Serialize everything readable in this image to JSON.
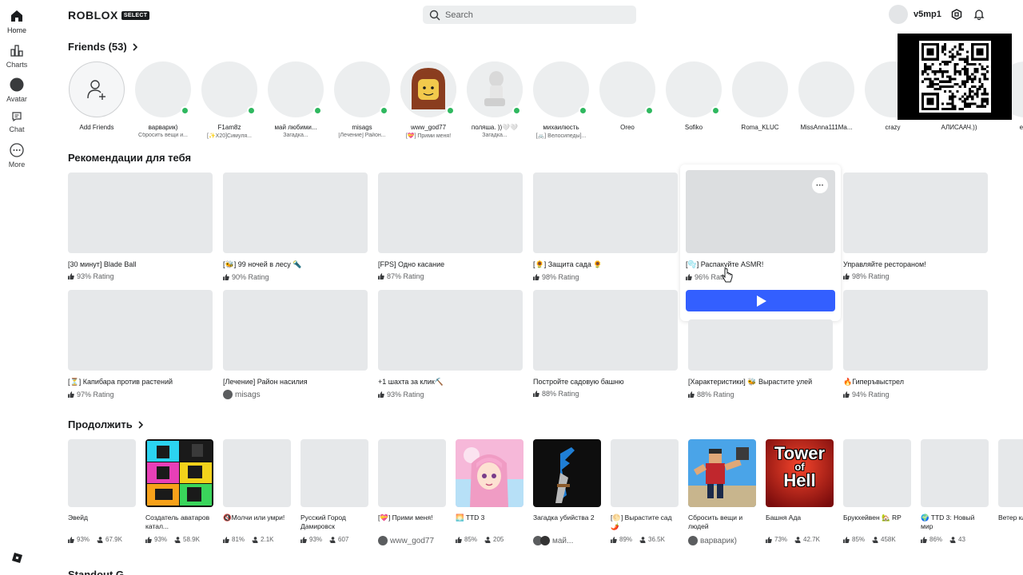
{
  "nav": {
    "items": [
      {
        "label": "Home",
        "icon": "home-icon"
      },
      {
        "label": "Charts",
        "icon": "charts-icon"
      },
      {
        "label": "Avatar",
        "icon": "avatar-icon"
      },
      {
        "label": "Chat",
        "icon": "chat-icon"
      },
      {
        "label": "More",
        "icon": "more-icon"
      }
    ]
  },
  "header": {
    "logo_text": "ROBLOX",
    "logo_badge": "SELECT",
    "search_placeholder": "Search",
    "username": "v5mp1"
  },
  "friends": {
    "title": "Friends (53)",
    "add_label": "Add Friends",
    "items": [
      {
        "name": "варварик)",
        "status": "Сбросить вещи и...",
        "online": true
      },
      {
        "name": "F1am8z",
        "status": "[✨X20]Симуля...",
        "online": true
      },
      {
        "name": "май любими...",
        "status": "Загадка...",
        "online": true
      },
      {
        "name": "misags",
        "status": "[Лечение] Район...",
        "online": true
      },
      {
        "name": "www_god77",
        "status": "[💝] Прими меня!",
        "online": true
      },
      {
        "name": "поляша. ))🤍🤍",
        "status": "Загадка...",
        "online": true
      },
      {
        "name": "михаилюсть",
        "status": "[🚲] Велосипеды]...",
        "online": true
      },
      {
        "name": "Oreo",
        "status": "",
        "online": true
      },
      {
        "name": "Sofiko",
        "status": "",
        "online": true
      },
      {
        "name": "Roma_KLUC",
        "status": "",
        "online": false
      },
      {
        "name": "MissAnna111Ma...",
        "status": "",
        "online": false
      },
      {
        "name": "crazy",
        "status": "",
        "online": false
      },
      {
        "name": "АЛИСААЧ.))",
        "status": "",
        "online": false
      },
      {
        "name": "eles",
        "status": "",
        "online": false
      }
    ]
  },
  "recommendations": {
    "title": "Рекомендации для тебя",
    "row1": [
      {
        "title": "[30 минут] Blade Ball",
        "rating": "93% Rating"
      },
      {
        "title": "[🐝] 99 ночей в лесу 🔦",
        "rating": "90% Rating"
      },
      {
        "title": "[FPS] Одно касание",
        "rating": "87% Rating"
      },
      {
        "title": "[🌻] Защита сада 🌻",
        "rating": "98% Rating"
      },
      {
        "title": "[🫧] Распакуйте ASMR!",
        "rating": "96% Rating"
      },
      {
        "title": "Управляйте рестораном!",
        "rating": "98% Rating"
      }
    ],
    "row2": [
      {
        "title": "[⏳] Капибара против растений",
        "rating": "97% Rating"
      },
      {
        "title": "[Лечение] Район насилия",
        "rating": "misags"
      },
      {
        "title": "+1 шахта за клик⛏️",
        "rating": "93% Rating"
      },
      {
        "title": "Постройте садовую башню",
        "rating": "88% Rating"
      },
      {
        "title": "[Характеристики] 🐝 Вырастите улей",
        "rating": "88% Rating"
      },
      {
        "title": "🔥Гиперъвыстрел",
        "rating": "94% Rating"
      }
    ]
  },
  "continue": {
    "title": "Продолжить",
    "items": [
      {
        "name": "Эвейд",
        "rating": "93%",
        "players": "67.9K"
      },
      {
        "name": "Создатель аватаров катал...",
        "rating": "93%",
        "players": "58.9K"
      },
      {
        "name": "🔇Молчи или умри!",
        "rating": "81%",
        "players": "2.1K"
      },
      {
        "name": "Русский Город Дамировск",
        "rating": "93%",
        "players": "607"
      },
      {
        "name": "[💝] Прими меня!",
        "rating": "",
        "players": "www_god77"
      },
      {
        "name": "🌅 TTD 3",
        "rating": "85%",
        "players": "205"
      },
      {
        "name": "Загадка убийства 2",
        "rating": "",
        "players": "май..."
      },
      {
        "name": "[🌕] Вырастите сад 🌶️",
        "rating": "89%",
        "players": "36.5K"
      },
      {
        "name": "Сбросить вещи и людей",
        "rating": "",
        "players": "варварик)"
      },
      {
        "name": "Башня Ада",
        "rating": "73%",
        "players": "42.7K"
      },
      {
        "name": "Брукхейвен 🏡 RP",
        "rating": "85%",
        "players": "458K"
      },
      {
        "name": "🌍 TTD 3: Новый мир",
        "rating": "86%",
        "players": "43"
      },
      {
        "name": "Ветер клини...",
        "rating": "",
        "players": ""
      }
    ],
    "tower_text": [
      "Tower",
      "of",
      "Hell"
    ]
  },
  "bottom_section_title": "Standout G..."
}
